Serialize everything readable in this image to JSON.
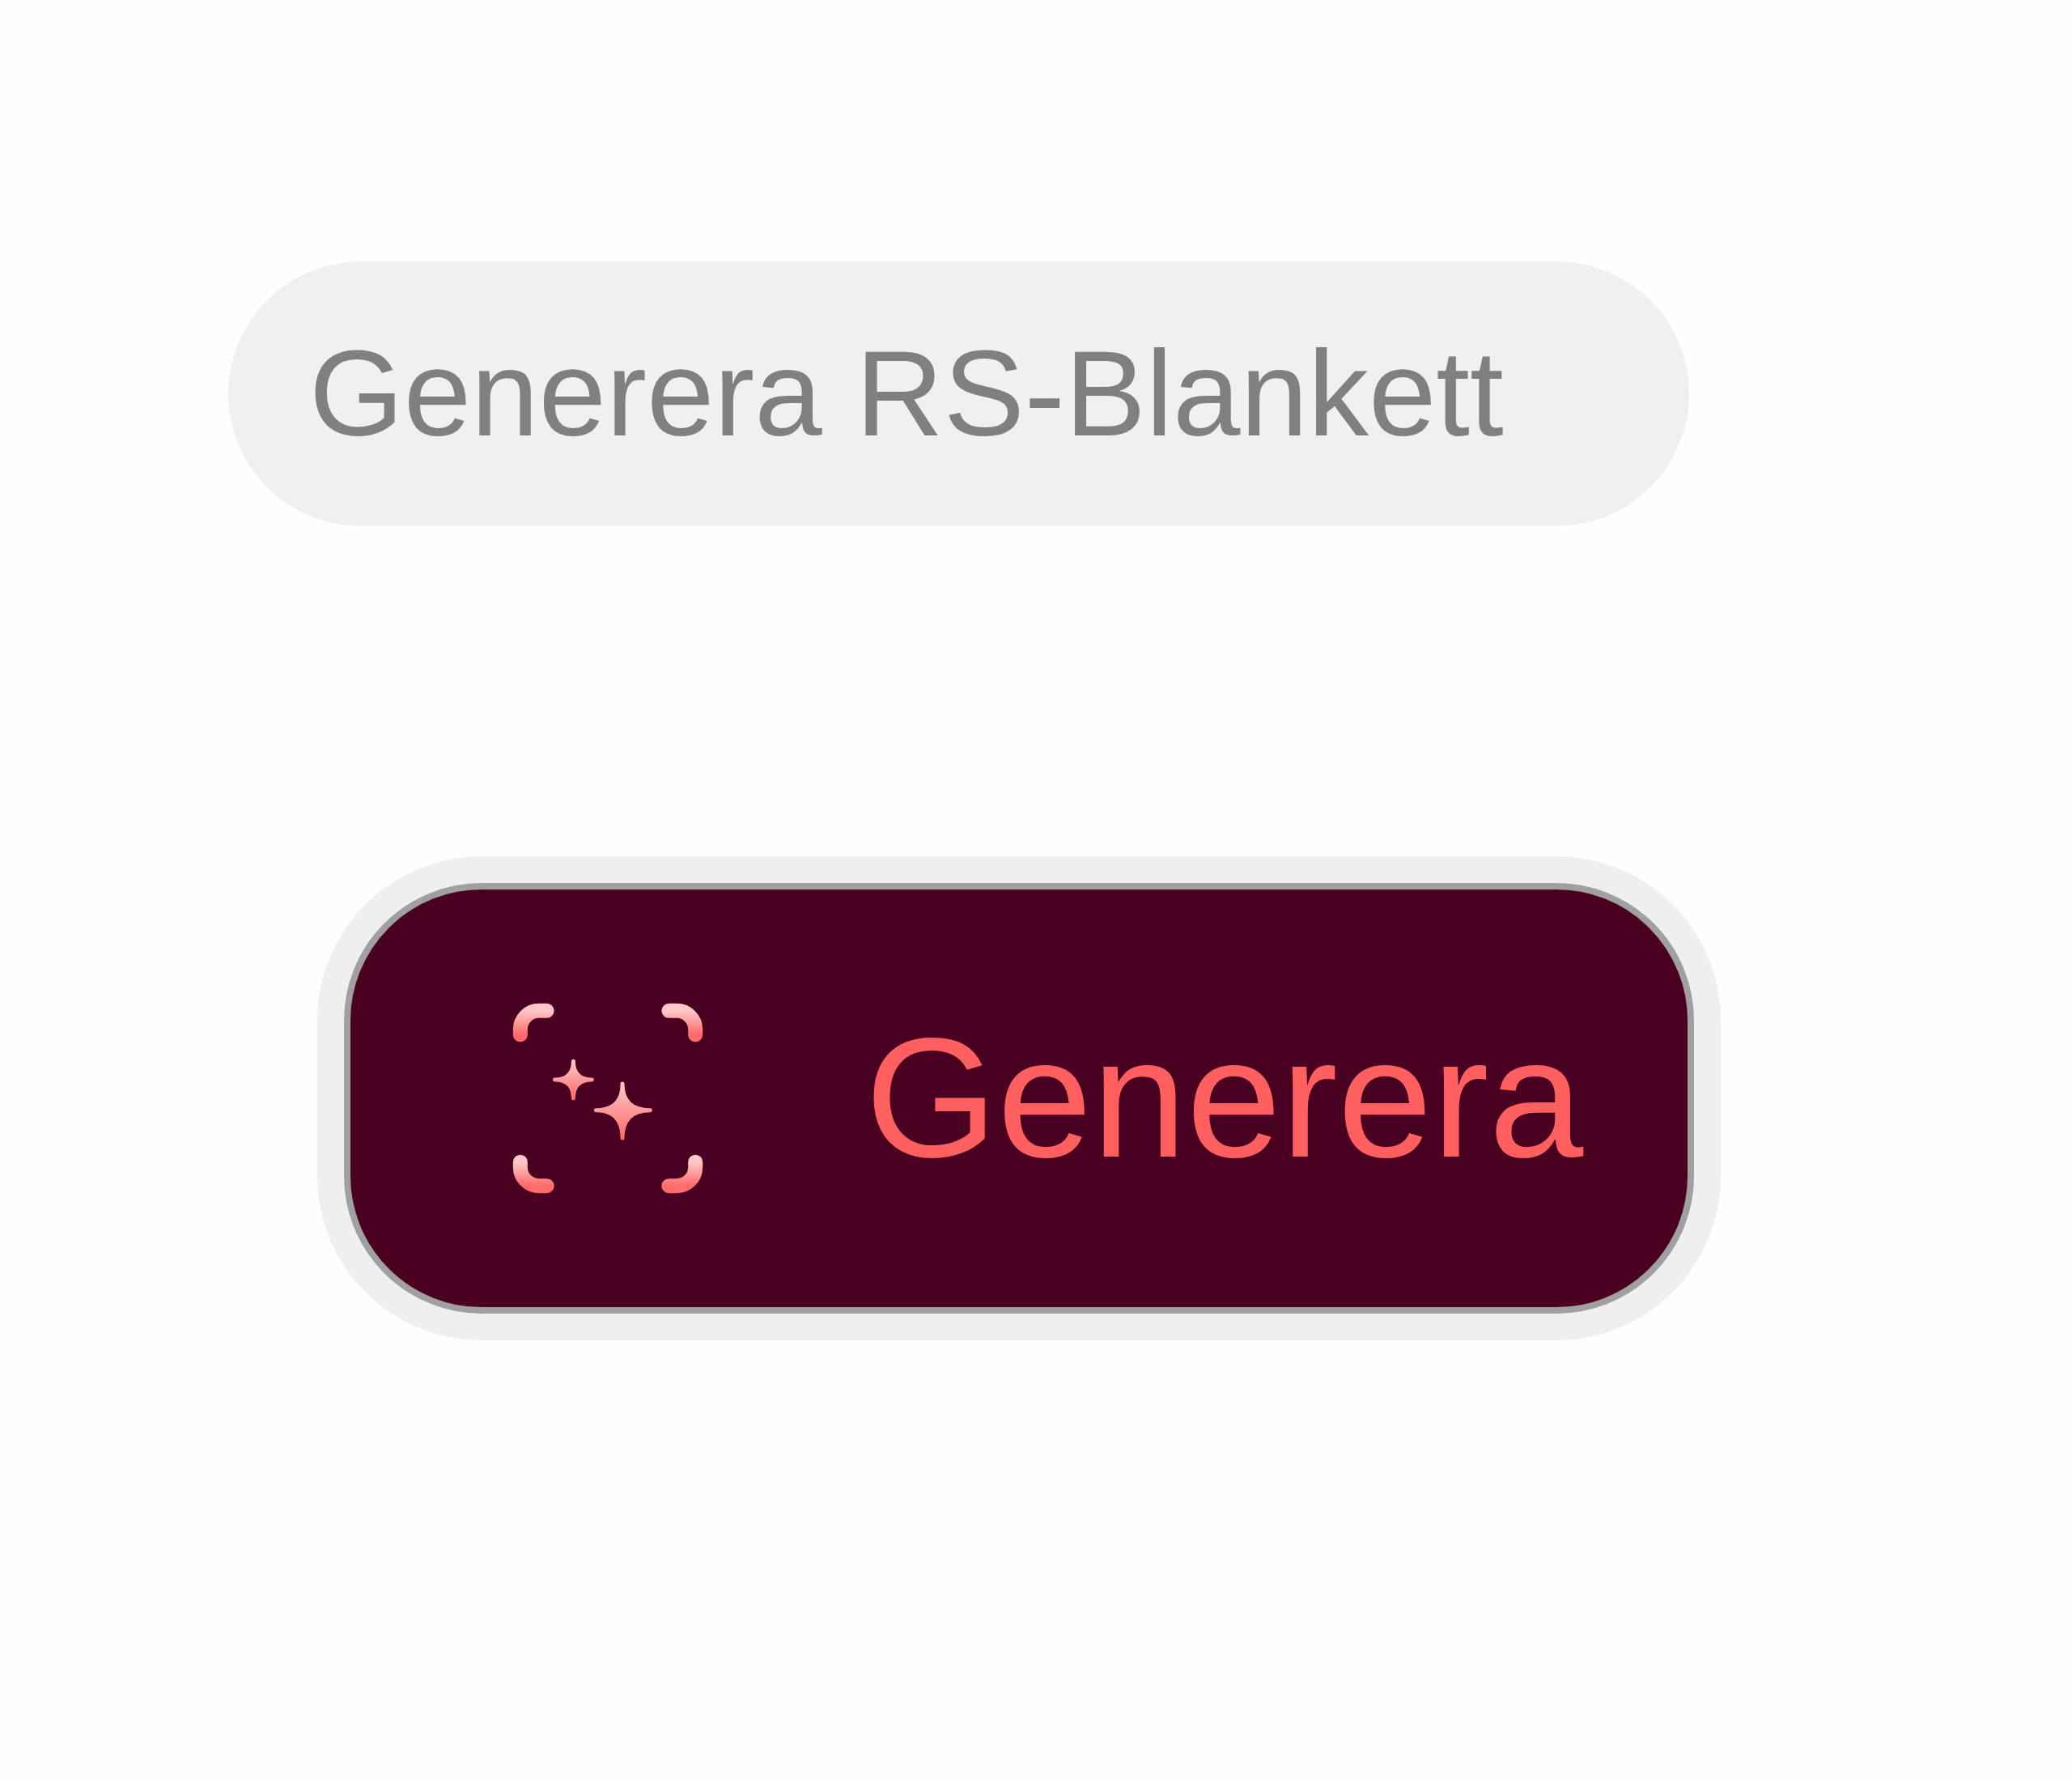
{
  "buttons": [
    {
      "label": "Generera RS-Blankett",
      "kind": "secondary"
    },
    {
      "label": "Generera",
      "kind": "primary"
    }
  ]
}
